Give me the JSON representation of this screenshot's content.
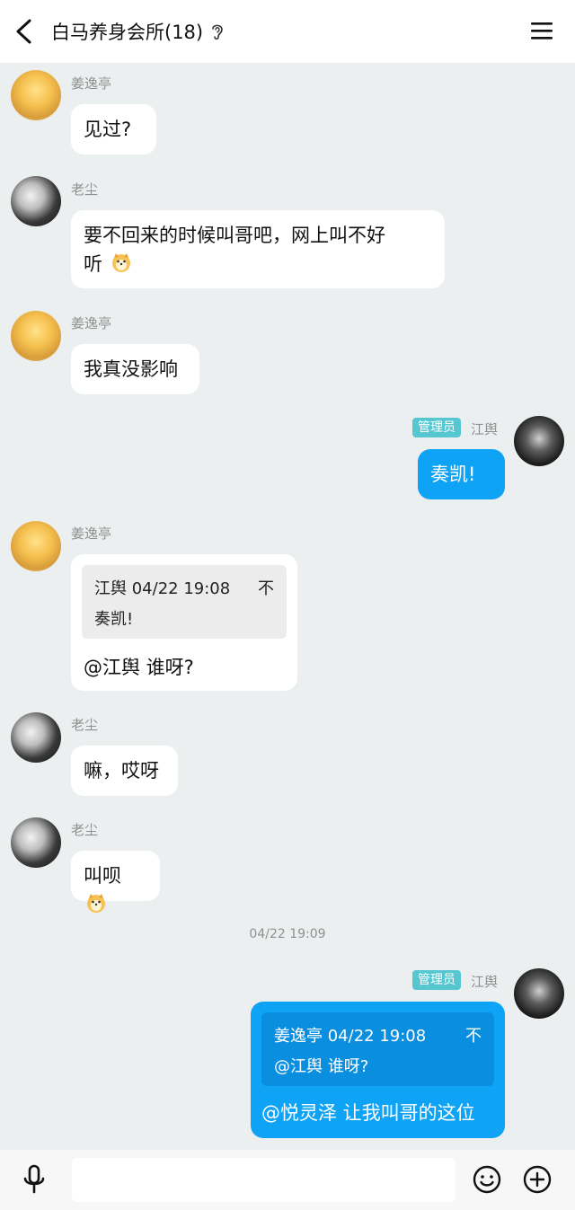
{
  "header": {
    "title": "白马养身会所(18)"
  },
  "messages": [
    {
      "sender": "姜逸亭",
      "text": "见过?"
    },
    {
      "sender": "老尘",
      "text_line1": "要不回来的时候叫哥吧，网上叫不好",
      "text_line2": "听"
    },
    {
      "sender": "姜逸亭",
      "text": "我真没影响"
    },
    {
      "sender": "江舆",
      "badge": "管理员",
      "text": "奏凯!"
    },
    {
      "sender": "姜逸亭",
      "quote": {
        "header": "江舆 04/22 19:08",
        "body": "奏凯!",
        "close": "不"
      },
      "text": "@江舆 谁呀?"
    },
    {
      "sender": "老尘",
      "text": "嘛，哎呀"
    },
    {
      "sender": "老尘",
      "text": "叫呗"
    },
    {
      "timestamp": "04/22 19:09"
    },
    {
      "sender": "江舆",
      "badge": "管理员",
      "quote": {
        "header": "姜逸亭 04/22 19:08",
        "body": "@江舆 谁呀?",
        "close": "不"
      },
      "text": "@悦灵泽 让我叫哥的这位"
    }
  ],
  "footer": {
    "input_value": ""
  },
  "icons": {
    "back": "chevron-left-icon",
    "menu": "hamburger-menu-icon",
    "ear": "ear-icon",
    "mic": "microphone-icon",
    "emoji": "smile-icon",
    "add": "plus-circle-icon"
  }
}
